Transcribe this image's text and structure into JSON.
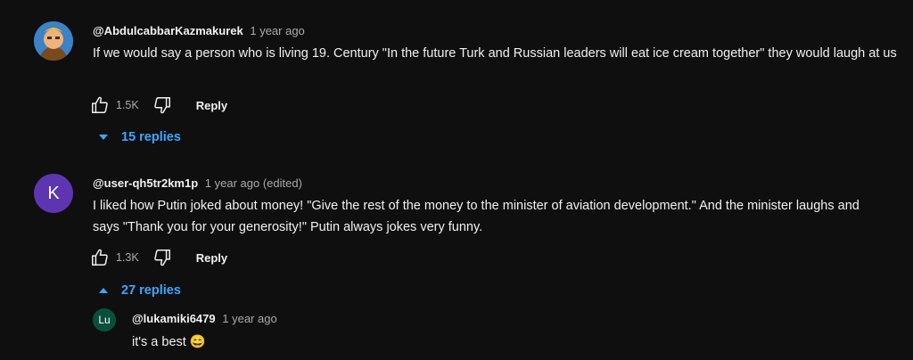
{
  "comments": [
    {
      "author": "@AbdulcabbarKazmakurek",
      "time": "1 year ago",
      "text": "If we would say a person who is living 19. Century \"In the future Turk and Russian leaders will eat ice cream together\" they  would laugh at us",
      "likes": "1.5K",
      "reply_label": "Reply",
      "replies_label": "15 replies",
      "replies_state": "collapsed"
    },
    {
      "author": "@user-qh5tr2km1p",
      "time": "1 year ago (edited)",
      "avatar_letter": "K",
      "avatar_color": "#5e35b1",
      "text": "I liked how Putin joked about money! \"Give the rest of the money to the minister of aviation development.\" And the minister laughs and says \"Thank you for your generosity!\" Putin always jokes very funny.",
      "likes": "1.3K",
      "reply_label": "Reply",
      "replies_label": "27 replies",
      "replies_state": "expanded"
    }
  ],
  "reply": {
    "author": "@lukamiki6479",
    "time": "1 year ago",
    "avatar_letter": "Lu",
    "avatar_color": "#0b4f3a",
    "text": "it's a best 😄"
  },
  "colors": {
    "background": "#0f0f0f",
    "link": "#3ea6ff",
    "meta": "#aaaaaa"
  },
  "icons": [
    "like-icon",
    "dislike-icon",
    "chevron-down-icon",
    "chevron-up-icon"
  ]
}
